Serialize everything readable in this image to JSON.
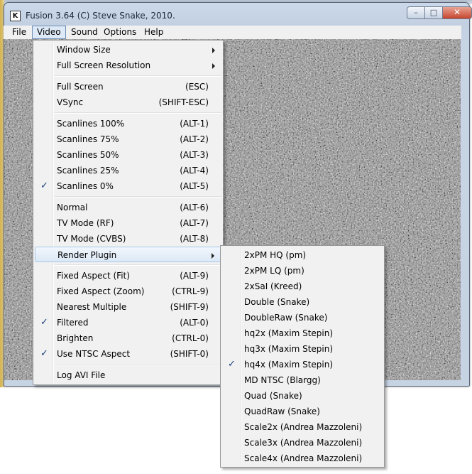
{
  "window": {
    "title": "Fusion 3.64 (C) Steve Snake, 2010.",
    "icon_text": "K",
    "icons": {
      "app": "kega-fusion-app-icon",
      "minimize": "minimize-icon",
      "maximize": "maximize-icon",
      "close": "close-icon"
    },
    "minimize_glyph": "–",
    "maximize_glyph": "□",
    "close_glyph": "✕"
  },
  "menubar": [
    {
      "label": "File",
      "active": false
    },
    {
      "label": "Video",
      "active": true
    },
    {
      "label": "Sound",
      "active": false
    },
    {
      "label": "Options",
      "active": false
    },
    {
      "label": "Help",
      "active": false
    }
  ],
  "video_menu": {
    "items": [
      {
        "label": "Window Size",
        "accel": "",
        "checked": false,
        "submenu": true
      },
      {
        "label": "Full Screen Resolution",
        "accel": "",
        "checked": false,
        "submenu": true
      },
      {
        "separator": true
      },
      {
        "label": "Full Screen",
        "accel": "(ESC)",
        "checked": false
      },
      {
        "label": "VSync",
        "accel": "(SHIFT-ESC)",
        "checked": false
      },
      {
        "separator": true
      },
      {
        "label": "Scanlines 100%",
        "accel": "(ALT-1)",
        "checked": false
      },
      {
        "label": "Scanlines 75%",
        "accel": "(ALT-2)",
        "checked": false
      },
      {
        "label": "Scanlines 50%",
        "accel": "(ALT-3)",
        "checked": false
      },
      {
        "label": "Scanlines 25%",
        "accel": "(ALT-4)",
        "checked": false
      },
      {
        "label": "Scanlines 0%",
        "accel": "(ALT-5)",
        "checked": true
      },
      {
        "separator": true
      },
      {
        "label": "Normal",
        "accel": "(ALT-6)",
        "checked": false
      },
      {
        "label": "TV Mode (RF)",
        "accel": "(ALT-7)",
        "checked": false
      },
      {
        "label": "TV Mode (CVBS)",
        "accel": "(ALT-8)",
        "checked": false
      },
      {
        "label": "Render Plugin",
        "accel": "",
        "checked": false,
        "submenu": true,
        "highlighted": true
      },
      {
        "separator": true
      },
      {
        "label": "Fixed Aspect (Fit)",
        "accel": "(ALT-9)",
        "checked": false
      },
      {
        "label": "Fixed Aspect (Zoom)",
        "accel": "(CTRL-9)",
        "checked": false
      },
      {
        "label": "Nearest Multiple",
        "accel": "(SHIFT-9)",
        "checked": false
      },
      {
        "label": "Filtered",
        "accel": "(ALT-0)",
        "checked": true
      },
      {
        "label": "Brighten",
        "accel": "(CTRL-0)",
        "checked": false
      },
      {
        "label": "Use NTSC Aspect",
        "accel": "(SHIFT-0)",
        "checked": true
      },
      {
        "separator": true
      },
      {
        "label": "Log AVI File",
        "accel": "",
        "checked": false
      }
    ]
  },
  "render_plugin_menu": {
    "items": [
      {
        "label": "2xPM HQ (pm)",
        "checked": false
      },
      {
        "label": "2xPM LQ (pm)",
        "checked": false
      },
      {
        "label": "2xSaI (Kreed)",
        "checked": false
      },
      {
        "label": "Double (Snake)",
        "checked": false
      },
      {
        "label": "DoubleRaw (Snake)",
        "checked": false
      },
      {
        "label": "hq2x (Maxim Stepin)",
        "checked": false
      },
      {
        "label": "hq3x (Maxim Stepin)",
        "checked": false
      },
      {
        "label": "hq4x (Maxim Stepin)",
        "checked": true
      },
      {
        "label": "MD NTSC (Blargg)",
        "checked": false
      },
      {
        "label": "Quad (Snake)",
        "checked": false
      },
      {
        "label": "QuadRaw (Snake)",
        "checked": false
      },
      {
        "label": "Scale2x (Andrea Mazzoleni)",
        "checked": false
      },
      {
        "label": "Scale3x (Andrea Mazzoleni)",
        "checked": false
      },
      {
        "label": "Scale4x (Andrea Mazzoleni)",
        "checked": false
      }
    ]
  },
  "check_glyph": "✓",
  "colors": {
    "highlight": "#dce9f6",
    "highlight_border": "#a9c7e8",
    "menu_bg": "#f1f1f1"
  }
}
